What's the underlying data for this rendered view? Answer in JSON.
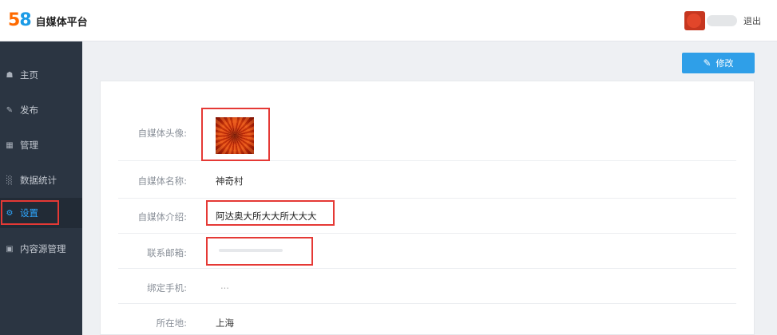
{
  "header": {
    "logo_digits": [
      "5",
      "8"
    ],
    "platform_name": "自媒体平台",
    "logout_label": "退出"
  },
  "sidebar": {
    "items": [
      {
        "label": "主页",
        "icon": "home-icon"
      },
      {
        "label": "发布",
        "icon": "edit-icon"
      },
      {
        "label": "管理",
        "icon": "grid-icon"
      },
      {
        "label": "数据统计",
        "icon": "bar-chart-icon"
      },
      {
        "label": "设置",
        "icon": "gear-icon",
        "active": true
      },
      {
        "label": "内容源管理",
        "icon": "content-source-icon"
      }
    ]
  },
  "toolbar": {
    "edit_label": "修改"
  },
  "profile": {
    "avatar_label": "自媒体头像:",
    "name_label": "自媒体名称:",
    "name_value": "神奇村",
    "intro_label": "自媒体介绍:",
    "intro_value": "阿达奥大所大大所大大大",
    "email_label": "联系邮箱:",
    "phone_label": "绑定手机:",
    "phone_value": "...",
    "location_label": "所在地:",
    "location_value": "上海"
  },
  "colors": {
    "accent": "#2f9fe8",
    "sidebar_bg": "#2b3542",
    "highlight_red": "#e53935",
    "logo_orange": "#ff6a00",
    "logo_blue": "#1c9be6"
  }
}
